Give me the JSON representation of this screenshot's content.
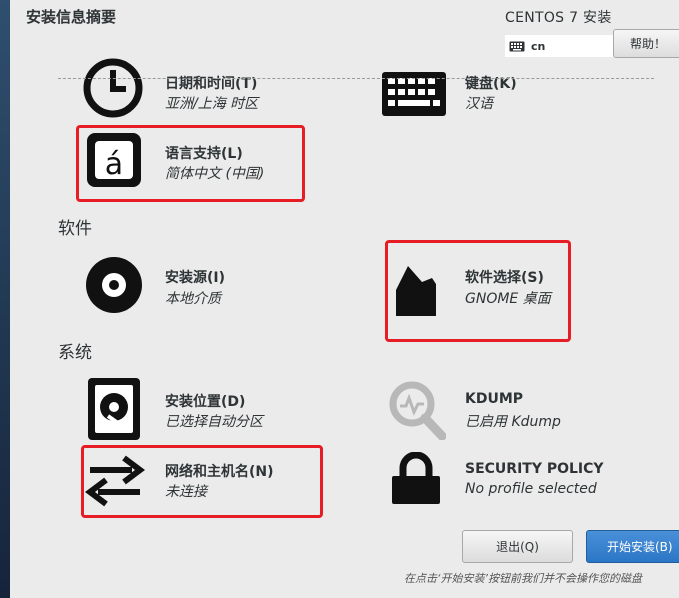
{
  "header": {
    "title": "安装信息摘要",
    "product": "CENTOS 7 安装",
    "keyboard_layout": "cn",
    "help_label": "帮助！"
  },
  "sections": {
    "localization": {
      "datetime": {
        "title": "日期和时间(T)",
        "status": "亚洲/上海 时区"
      },
      "keyboard": {
        "title": "键盘(K)",
        "status": "汉语"
      },
      "language": {
        "title": "语言支持(L)",
        "status": "简体中文 (中国)"
      }
    },
    "software": {
      "title": "软件",
      "source": {
        "title": "安装源(I)",
        "status": "本地介质"
      },
      "selection": {
        "title": "软件选择(S)",
        "status": "GNOME 桌面"
      }
    },
    "system": {
      "title": "系统",
      "destination": {
        "title": "安装位置(D)",
        "status": "已选择自动分区"
      },
      "kdump": {
        "title": "KDUMP",
        "status": "已启用 Kdump"
      },
      "network": {
        "title": "网络和主机名(N)",
        "status": "未连接"
      },
      "security": {
        "title": "SECURITY POLICY",
        "status": "No profile selected"
      }
    }
  },
  "footer": {
    "quit_label": "退出(Q)",
    "begin_label": "开始安装(B)",
    "note": "在点击‘开始安装’按钮前我们并不会操作您的磁盘"
  },
  "colors": {
    "highlight_box": "#e61d25",
    "primary_button": "#2a76c6",
    "background": "#ebebeb"
  },
  "icons": [
    "keyboard-icon",
    "clock-icon",
    "keyboard-layout-icon",
    "language-icon",
    "disc-icon",
    "package-icon",
    "harddisk-icon",
    "kdump-search-icon",
    "network-arrows-icon",
    "lock-icon"
  ]
}
